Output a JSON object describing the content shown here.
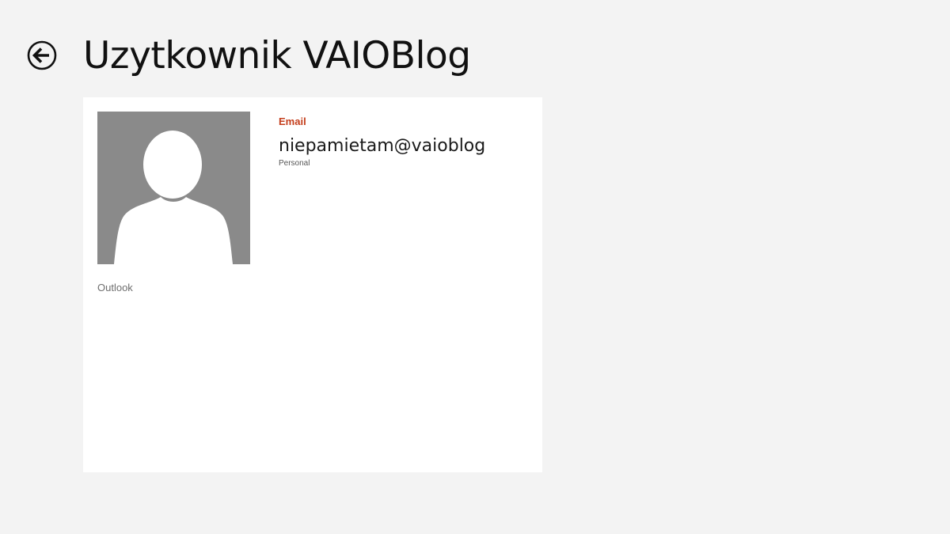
{
  "header": {
    "title": "Uzytkownik VAIOBlog",
    "back_icon": "back-arrow-circle-icon"
  },
  "contact": {
    "avatar_icon": "person-placeholder-icon",
    "source": "Outlook",
    "email": {
      "heading": "Email",
      "value": "niepamietam@vaioblog",
      "type": "Personal"
    }
  },
  "colors": {
    "background": "#f3f3f3",
    "card": "#ffffff",
    "accent": "#c43e1c",
    "avatar_bg": "#8a8a8a"
  }
}
